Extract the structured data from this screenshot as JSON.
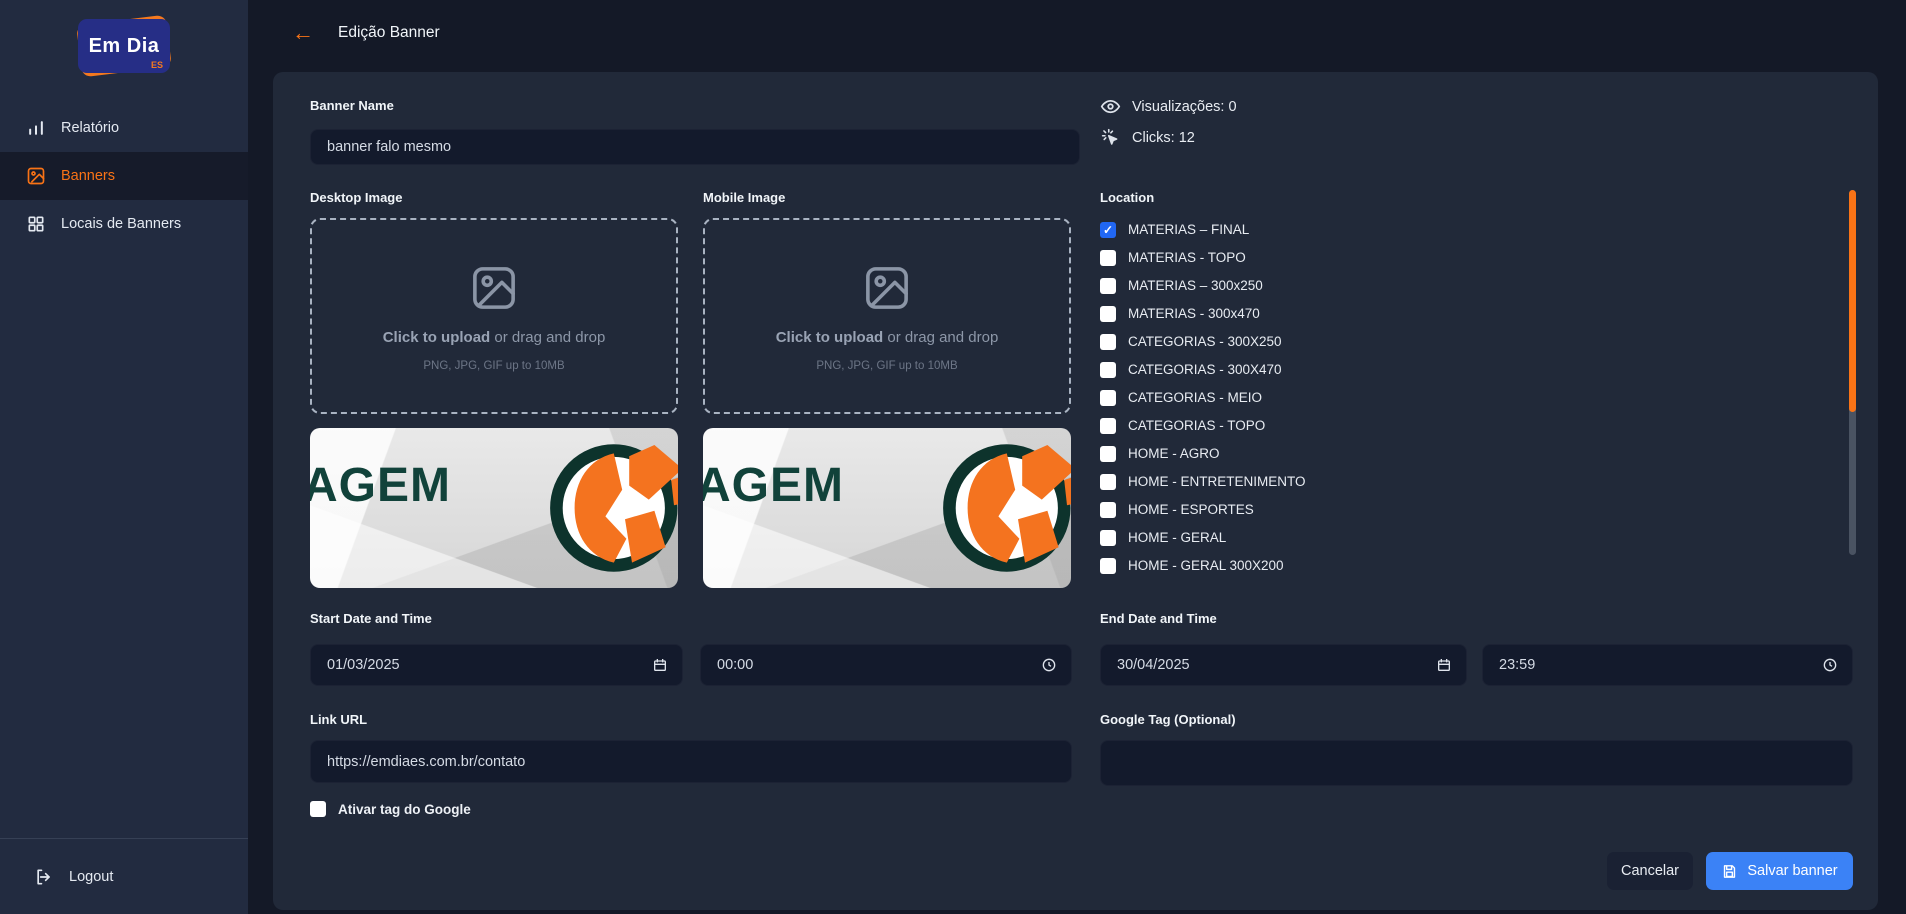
{
  "sidebar": {
    "logo_text": "Em Dia",
    "logo_sub": "ES",
    "items": [
      {
        "label": "Relatório",
        "icon": "bar-chart-icon",
        "active": false
      },
      {
        "label": "Banners",
        "icon": "image-icon",
        "active": true
      },
      {
        "label": "Locais de Banners",
        "icon": "grid-icon",
        "active": false
      }
    ],
    "logout_label": "Logout"
  },
  "header": {
    "title": "Edição Banner",
    "back_icon": "←"
  },
  "form": {
    "banner_name": {
      "label": "Banner Name",
      "value": "banner falo mesmo"
    },
    "stats": {
      "views_text": "Visualizações: 0",
      "clicks_text": "Clicks: 12"
    },
    "desktop_image": {
      "label": "Desktop Image",
      "upload_primary": "Click to upload",
      "upload_secondary": " or drag and drop",
      "upload_hint": "PNG, JPG, GIF up to 10MB",
      "preview_text": "AGEM"
    },
    "mobile_image": {
      "label": "Mobile Image",
      "upload_primary": "Click to upload",
      "upload_secondary": " or drag and drop",
      "upload_hint": "PNG, JPG, GIF up to 10MB",
      "preview_text": "AGEM"
    },
    "location": {
      "label": "Location",
      "options": [
        {
          "label": "MATERIAS – FINAL",
          "checked": true
        },
        {
          "label": "MATERIAS - TOPO",
          "checked": false
        },
        {
          "label": "MATERIAS – 300x250",
          "checked": false
        },
        {
          "label": "MATERIAS - 300x470",
          "checked": false
        },
        {
          "label": "CATEGORIAS - 300X250",
          "checked": false
        },
        {
          "label": "CATEGORIAS - 300X470",
          "checked": false
        },
        {
          "label": "CATEGORIAS - MEIO",
          "checked": false
        },
        {
          "label": "CATEGORIAS - TOPO",
          "checked": false
        },
        {
          "label": "HOME - AGRO",
          "checked": false
        },
        {
          "label": "HOME - ENTRETENIMENTO",
          "checked": false
        },
        {
          "label": "HOME - ESPORTES",
          "checked": false
        },
        {
          "label": "HOME - GERAL",
          "checked": false
        },
        {
          "label": "HOME - GERAL 300X200",
          "checked": false
        }
      ]
    },
    "start": {
      "label": "Start Date and Time",
      "date": "01/03/2025",
      "time": "00:00"
    },
    "end": {
      "label": "End Date and Time",
      "date": "30/04/2025",
      "time": "23:59"
    },
    "link_url": {
      "label": "Link URL",
      "value": "https://emdiaes.com.br/contato"
    },
    "google_tag": {
      "label": "Google Tag (Optional)",
      "value": ""
    },
    "google_checkbox": {
      "label": "Ativar tag do Google",
      "checked": false
    },
    "actions": {
      "cancel_label": "Cancelar",
      "save_label": "Salvar banner"
    }
  },
  "colors": {
    "accent_orange": "#f97316",
    "save_blue": "#3b82f6",
    "checkbox_blue": "#2167f3",
    "panel_bg": "#212939",
    "sidebar_bg": "#222b40",
    "page_bg": "#141927"
  }
}
